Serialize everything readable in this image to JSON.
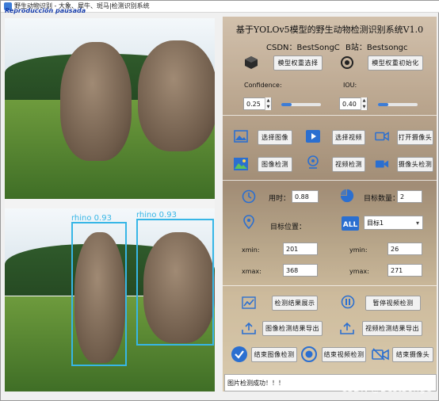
{
  "window": {
    "title": "野生动物识别  - 大象、犀牛、斑马|检测识别系统",
    "overlay_label": "Reproducción pausada"
  },
  "header": {
    "title": "基于YOLOv5模型的野生动物检测识别系统V1.0",
    "csdn_label": "CSDN：BestSongC",
    "bilibili_label": "B站：Bestsongc"
  },
  "model": {
    "select_button": "模型权重选择",
    "init_button": "模型权重初始化"
  },
  "params": {
    "confidence_label": "Confidence:",
    "confidence_value": "0.25",
    "confidence_fraction": 0.25,
    "iou_label": "IOU:",
    "iou_value": "0.40",
    "iou_fraction": 0.25
  },
  "media": {
    "select_image": "选择图像",
    "select_video": "选择视频",
    "open_camera": "打开摄像头",
    "image_detect": "图像检测",
    "video_detect": "视频检测",
    "camera_detect": "摄像头检测"
  },
  "results": {
    "time_label": "用时：",
    "time_value": "0.88",
    "count_label": "目标数量：",
    "count_value": "2",
    "position_label": "目标位置：",
    "target_select": "目标1",
    "xmin_label": "xmin:",
    "xmin_value": "201",
    "ymin_label": "ymin:",
    "ymin_value": "26",
    "xmax_label": "xmax:",
    "xmax_value": "368",
    "ymax_label": "ymax:",
    "ymax_value": "271"
  },
  "actions": {
    "show_results": "检测结果展示",
    "pause_video": "暂停视频检测",
    "export_image": "图像检测结果导出",
    "export_video": "视频检测结果导出",
    "stop_image": "结束图像检测",
    "stop_video": "结束视频检测",
    "stop_camera": "结束摄像头"
  },
  "detections": [
    {
      "label": "rhino",
      "score": "0.93",
      "text": "rhino  0.93"
    },
    {
      "label": "rhino",
      "score": "0.93",
      "text": "rhino  0.93"
    }
  ],
  "status": {
    "message": "图片检测成功！！！"
  },
  "watermark": "CSDN @BestSongC",
  "colors": {
    "accent": "#3c7cd6",
    "detection_box": "#37b6e6"
  }
}
